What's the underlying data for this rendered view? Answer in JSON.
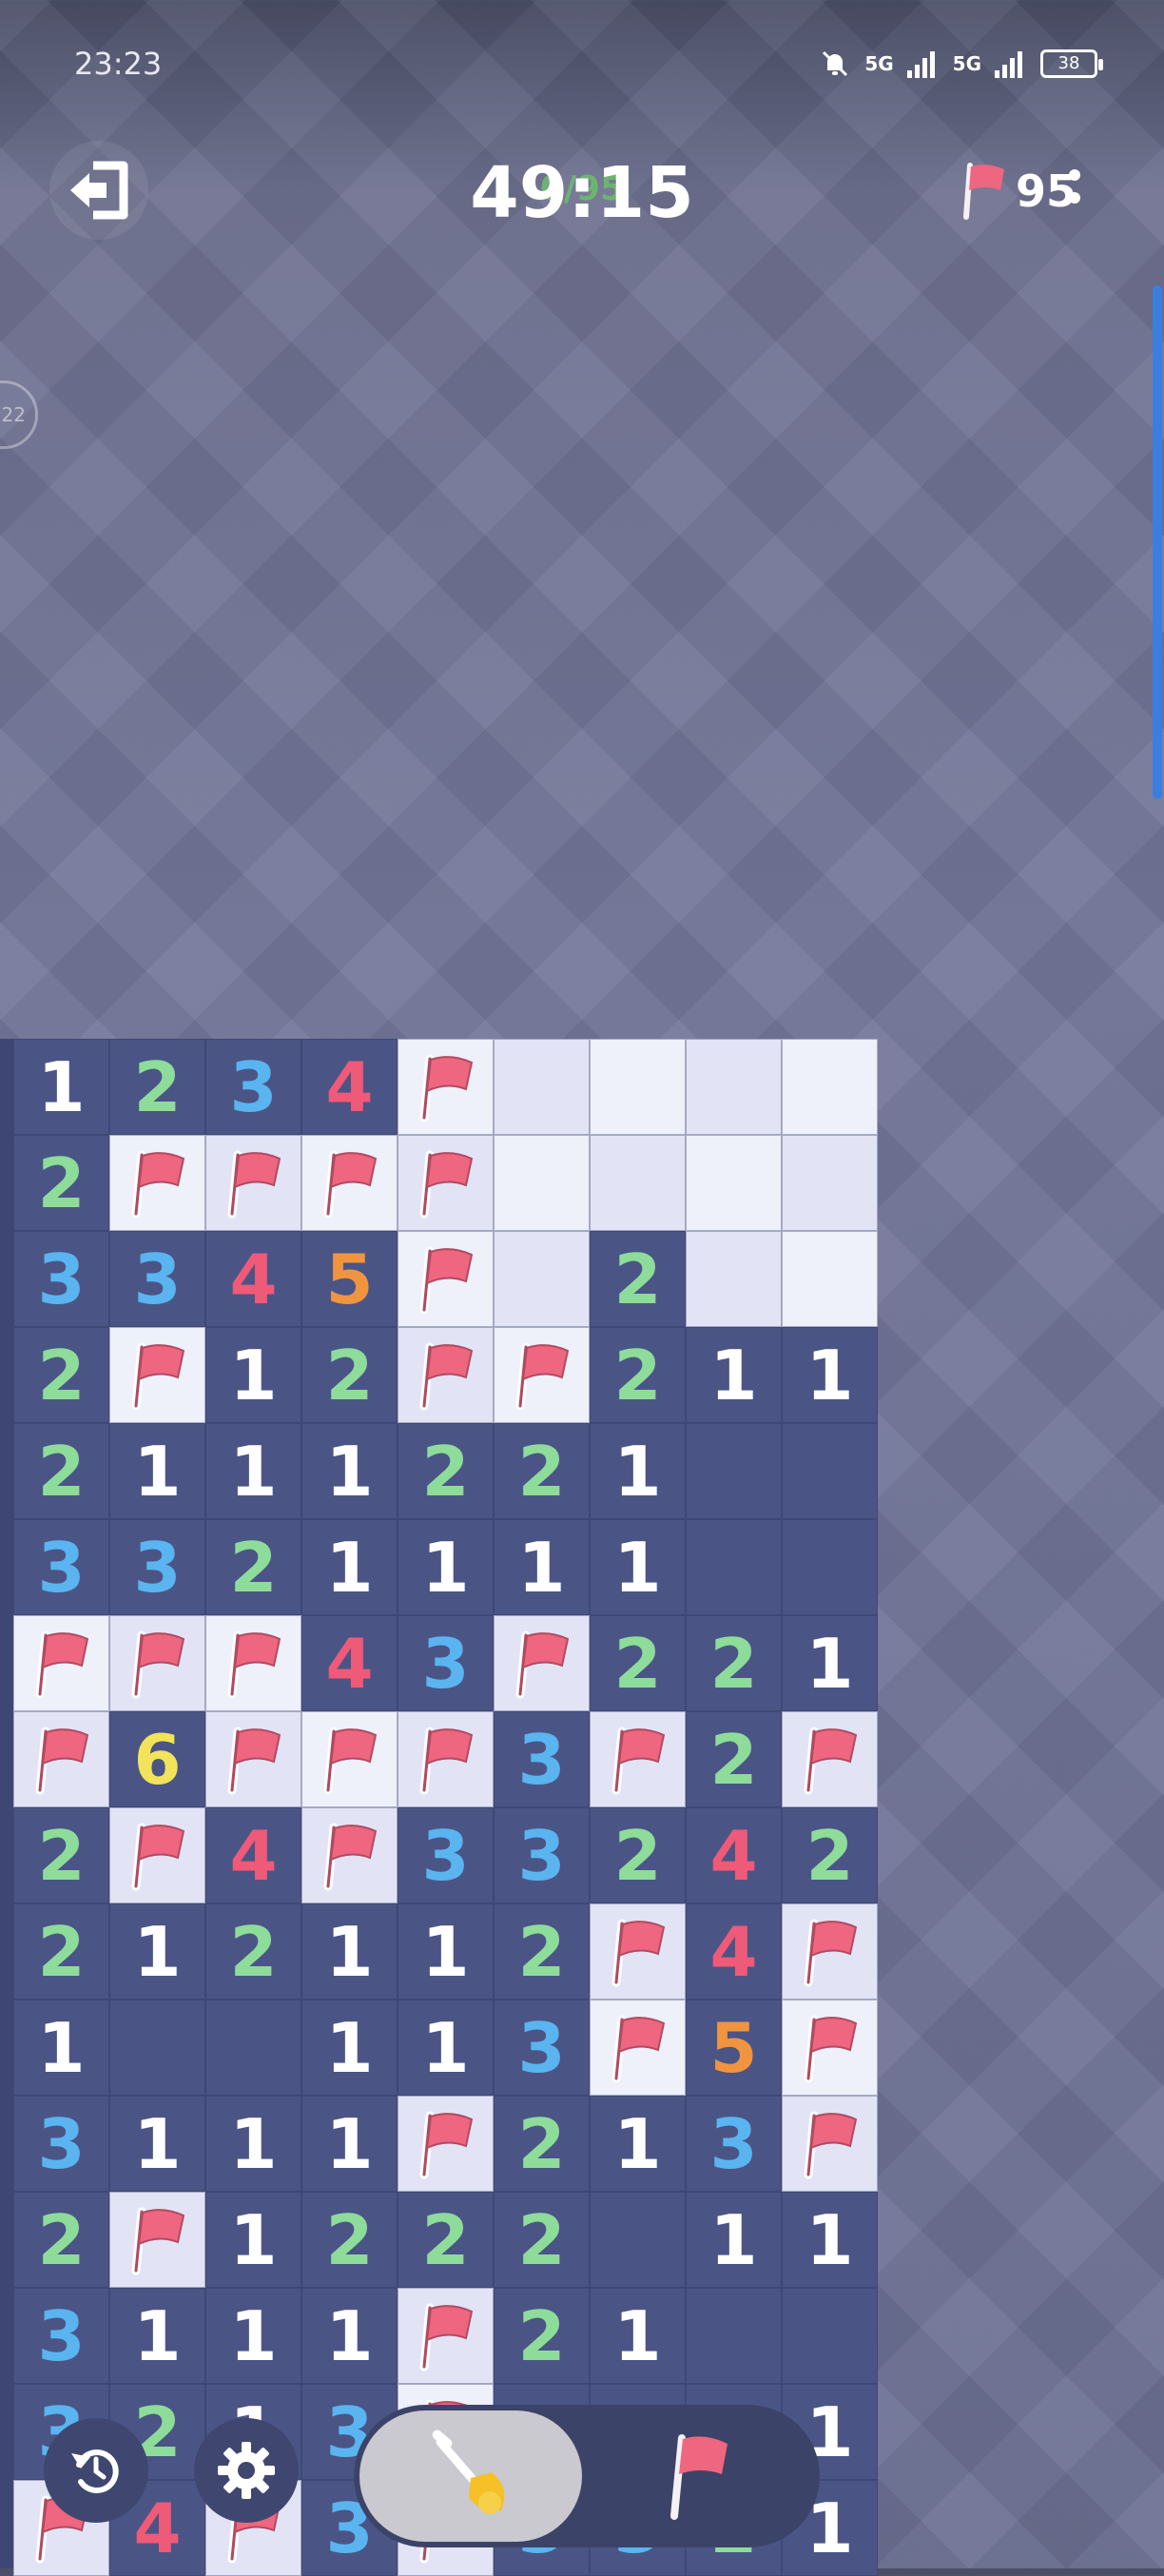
{
  "status_bar": {
    "time": "23:23",
    "signal_1": "5G",
    "signal_2": "5G",
    "battery": "38"
  },
  "header": {
    "timer": "49:15",
    "progress": "0/95",
    "flags_remaining": "95"
  },
  "side_badge": "22",
  "colors": {
    "1": "#ffffff",
    "2": "#8edc9a",
    "3": "#5ab4f0",
    "4": "#ee5a78",
    "5": "#f09440",
    "6": "#f2e35a",
    "flag": "#ee6680"
  },
  "board": {
    "legend": "F = flag, number = revealed count, . = revealed empty, L = unrevealed light tile",
    "rows": [
      [
        "1",
        "2",
        "3",
        "4",
        "F",
        "L",
        "L",
        "L",
        "L"
      ],
      [
        "2",
        "F",
        "F",
        "F",
        "F",
        "L",
        "L",
        "L",
        "L"
      ],
      [
        "3",
        "3",
        "4",
        "5",
        "F",
        "L",
        "2",
        "L",
        "L"
      ],
      [
        "2",
        "F",
        "1",
        "2",
        "F",
        "F",
        "2",
        "1",
        "1"
      ],
      [
        "2",
        "1",
        "1",
        "1",
        "2",
        "2",
        "1",
        ".",
        "."
      ],
      [
        "3",
        "3",
        "2",
        "1",
        "1",
        "1",
        "1",
        ".",
        "."
      ],
      [
        "F",
        "F",
        "F",
        "4",
        "3",
        "F",
        "2",
        "2",
        "1"
      ],
      [
        "F",
        "6",
        "F",
        "F",
        "F",
        "3",
        "F",
        "2",
        "F"
      ],
      [
        "2",
        "F",
        "4",
        "F",
        "3",
        "3",
        "2",
        "4",
        "2"
      ],
      [
        "2",
        "1",
        "2",
        "1",
        "1",
        "2",
        "F",
        "4",
        "F"
      ],
      [
        "1",
        ".",
        ".",
        "1",
        "1",
        "3",
        "F",
        "5",
        "F"
      ],
      [
        "3",
        "1",
        "1",
        "1",
        "F",
        "2",
        "1",
        "3",
        "F"
      ],
      [
        "2",
        "F",
        "1",
        "2",
        "2",
        "2",
        ".",
        "1",
        "1"
      ],
      [
        "3",
        "1",
        "1",
        "1",
        "F",
        "2",
        "1",
        ".",
        "."
      ],
      [
        "3",
        "2",
        "1",
        "3",
        "F",
        "3",
        "3",
        "2",
        "1"
      ],
      [
        "F",
        "4",
        "F",
        "3",
        "F",
        "3",
        "3",
        "2",
        "1"
      ]
    ]
  },
  "toolbar": {
    "restart": "restart",
    "settings": "settings",
    "dig_mode": "dig",
    "flag_mode": "flag"
  }
}
